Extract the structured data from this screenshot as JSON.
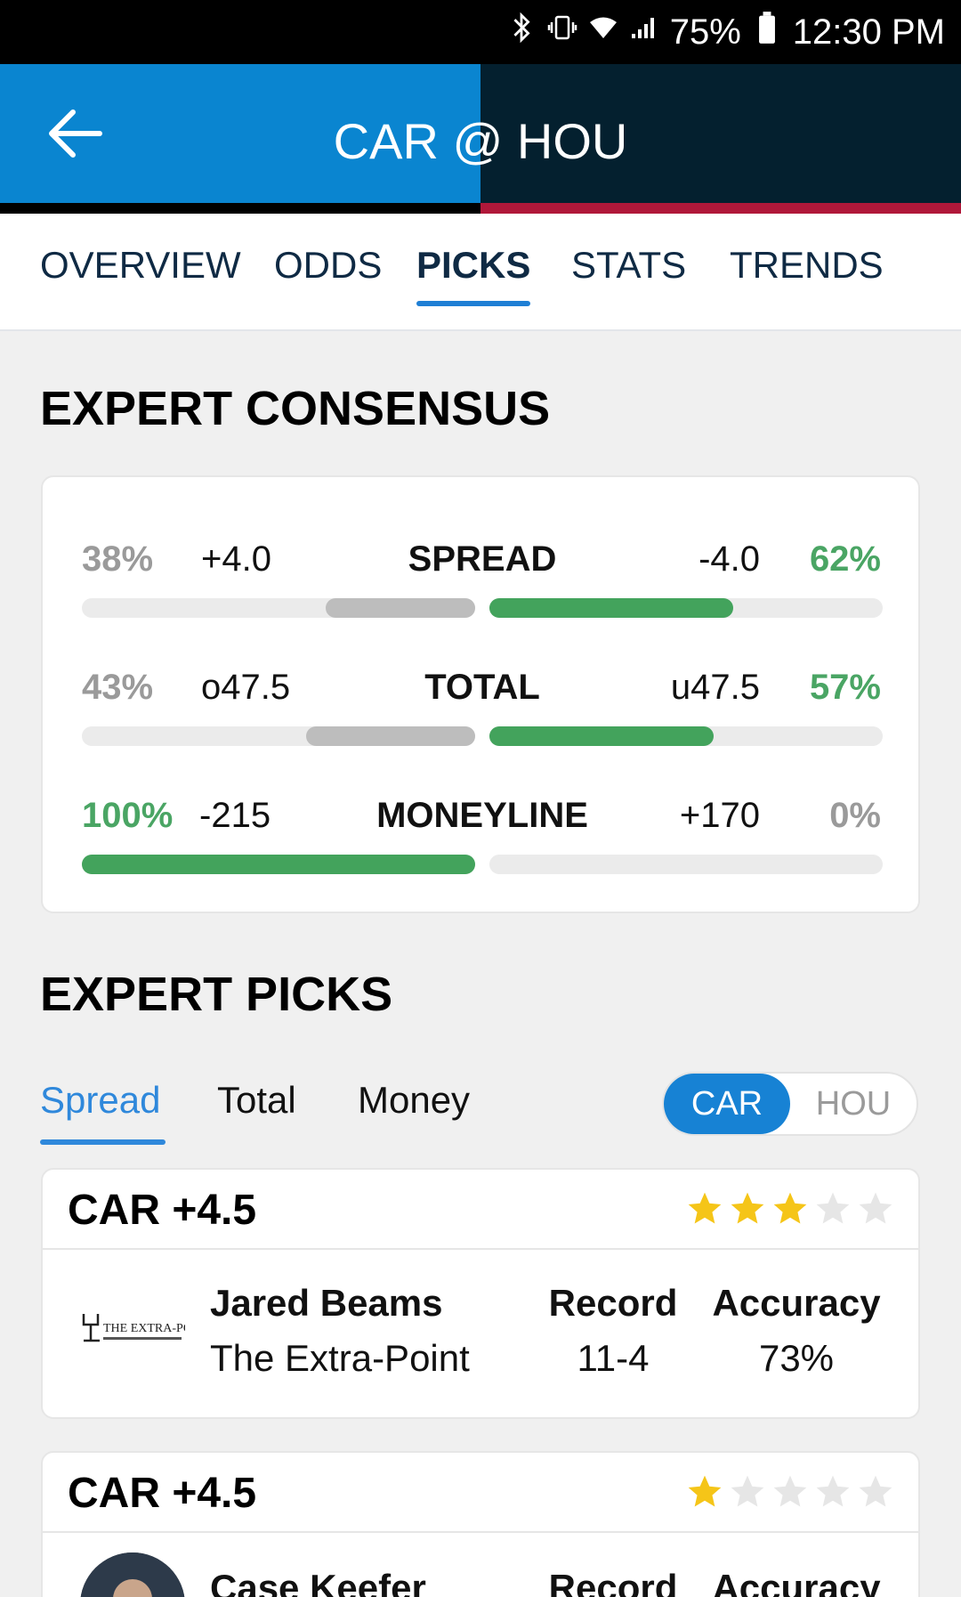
{
  "status_bar": {
    "battery": "75%",
    "time": "12:30 PM"
  },
  "header": {
    "title": "CAR @ HOU"
  },
  "tabs": [
    "OVERVIEW",
    "ODDS",
    "PICKS",
    "STATS",
    "TRENDS"
  ],
  "active_tab": "PICKS",
  "consensus": {
    "title": "EXPERT CONSENSUS",
    "rows": [
      {
        "label": "SPREAD",
        "left_pct": "38%",
        "left_odds": "+4.0",
        "right_odds": "-4.0",
        "right_pct": "62%",
        "left_share": 0.38,
        "right_share": 0.62
      },
      {
        "label": "TOTAL",
        "left_pct": "43%",
        "left_odds": "o47.5",
        "right_odds": "u47.5",
        "right_pct": "57%",
        "left_share": 0.43,
        "right_share": 0.57
      },
      {
        "label": "MONEYLINE",
        "left_pct": "100%",
        "left_odds": "-215",
        "right_odds": "+170",
        "right_pct": "0%",
        "left_share": 1.0,
        "right_share": 0.0
      }
    ]
  },
  "picks": {
    "title": "EXPERT PICKS",
    "filters": [
      "Spread",
      "Total",
      "Money"
    ],
    "active_filter": "Spread",
    "team_toggle": {
      "left": "CAR",
      "right": "HOU",
      "selected": "CAR"
    },
    "columns": {
      "record": "Record",
      "accuracy": "Accuracy"
    },
    "items": [
      {
        "pick": "CAR +4.5",
        "rating": 3,
        "rating_max": 5,
        "expert": "Jared Beams",
        "org": "The Extra-Point",
        "record": "11-4",
        "accuracy": "73%",
        "logo_text": "THE EXTRA-POINT"
      },
      {
        "pick": "CAR +4.5",
        "rating": 1,
        "rating_max": 5,
        "expert": "Case Keefer",
        "org": "",
        "record": "",
        "accuracy": ""
      }
    ]
  },
  "colors": {
    "header_left": "#0a85d0",
    "header_right": "#04202f",
    "accent_red": "#b0183a",
    "green": "#43a35c",
    "star_gold": "#f5c518"
  }
}
